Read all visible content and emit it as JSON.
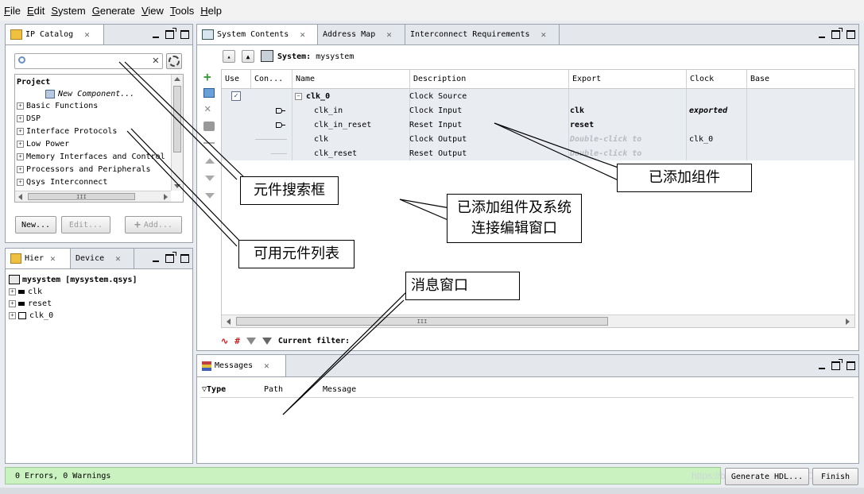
{
  "menu": [
    "File",
    "Edit",
    "System",
    "Generate",
    "View",
    "Tools",
    "Help"
  ],
  "ip_catalog": {
    "tab_label": "IP Catalog",
    "search_placeholder": "",
    "project_label": "Project",
    "new_component": "New Component...",
    "items": [
      "Basic Functions",
      "DSP",
      "Interface Protocols",
      "Low Power",
      "Memory Interfaces and Control",
      "Processors and Peripherals",
      "Qsys Interconnect"
    ],
    "scroll_mark": "III",
    "btn_new": "New...",
    "btn_edit": "Edit...",
    "btn_add": "Add..."
  },
  "hierarchy": {
    "tab_hier": "Hier",
    "tab_device": "Device",
    "root": "mysystem [mysystem.qsys]",
    "items": [
      "clk",
      "reset",
      "clk_0"
    ]
  },
  "system_contents": {
    "tabs": [
      "System Contents",
      "Address Map",
      "Interconnect Requirements"
    ],
    "system_label": "System:",
    "system_name": "mysystem",
    "columns": [
      "Use",
      "Con...",
      "Name",
      "Description",
      "Export",
      "Clock",
      "Base"
    ],
    "rows": [
      {
        "name": "clk_0",
        "description": "Clock Source",
        "export": "",
        "clock": ""
      },
      {
        "name": "clk_in",
        "description": "Clock Input",
        "export": "clk",
        "clock": "exported"
      },
      {
        "name": "clk_in_reset",
        "description": "Reset Input",
        "export": "reset",
        "clock": ""
      },
      {
        "name": "clk",
        "description": "Clock Output",
        "export": "Double-click to",
        "clock": "clk_0"
      },
      {
        "name": "clk_reset",
        "description": "Reset Output",
        "export": "Double-click to",
        "clock": ""
      }
    ],
    "scroll_mark": "III",
    "filter_label": "Current filter:"
  },
  "messages": {
    "tab_label": "Messages",
    "columns": [
      "Type",
      "Path",
      "Message"
    ]
  },
  "status": {
    "text": "0 Errors, 0 Warnings",
    "btn_generate": "Generate HDL...",
    "btn_finish": "Finish",
    "watermark": "https://blog.csdn.net/Ferry_D"
  },
  "callouts": {
    "search_box": "元件搜索框",
    "available_list": "可用元件列表",
    "added_components": "已添加组件",
    "edit_window": "已添加组件及系统连接编辑窗口",
    "message_window": "消息窗口"
  },
  "colors": {
    "accent_status": "#c9f2c0",
    "selection": "#dfe8f3"
  }
}
